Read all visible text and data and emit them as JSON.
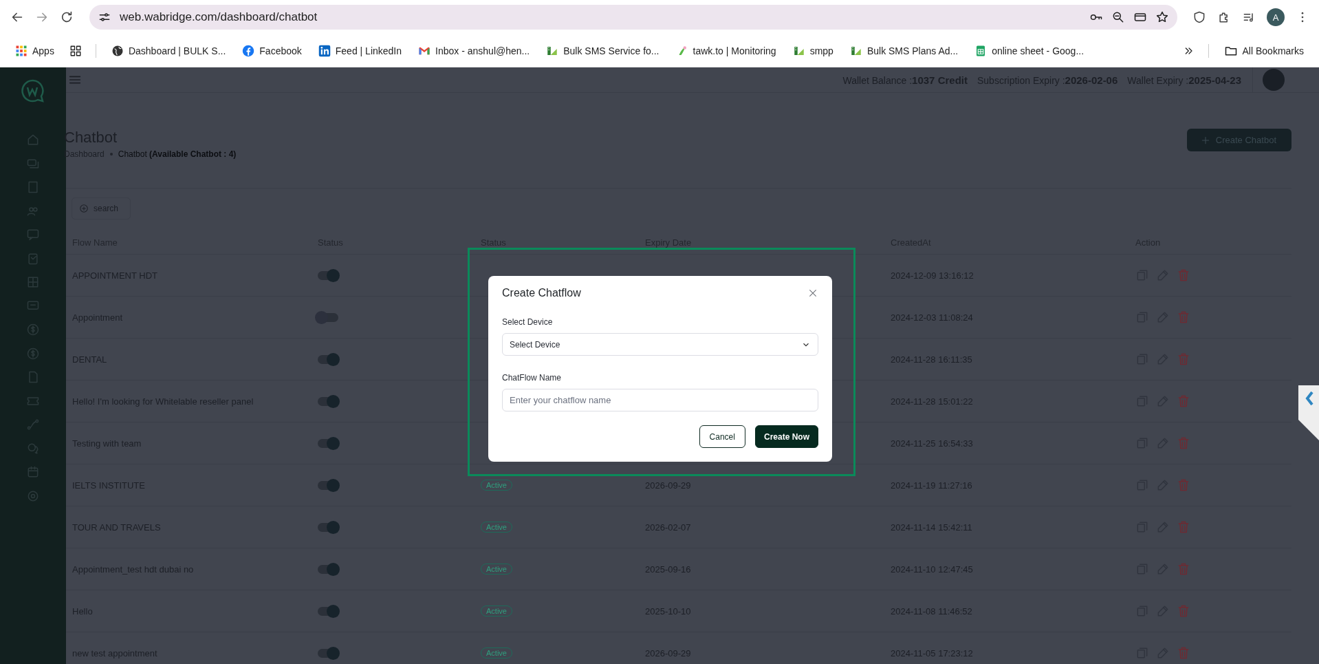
{
  "browser": {
    "url": "web.wabridge.com/dashboard/chatbot",
    "profile": "A",
    "bookmarks": [
      {
        "label": "Apps",
        "kind": "apps"
      },
      {
        "label": "Dashboard | BULK S...",
        "kind": "globe"
      },
      {
        "label": "Facebook",
        "kind": "facebook"
      },
      {
        "label": "Feed | LinkedIn",
        "kind": "linkedin"
      },
      {
        "label": "Inbox - anshul@hen...",
        "kind": "mail"
      },
      {
        "label": "Bulk SMS Service fo...",
        "kind": "bulk"
      },
      {
        "label": "tawk.to | Monitoring",
        "kind": "tawk"
      },
      {
        "label": "smpp",
        "kind": "bulk"
      },
      {
        "label": "Bulk SMS Plans Ad...",
        "kind": "bulk"
      },
      {
        "label": "online sheet - Goog...",
        "kind": "sheet"
      }
    ],
    "all_bookmarks": "All Bookmarks"
  },
  "header": {
    "wallet_balance": "Wallet Balance :**1037 Credit**",
    "subscription_expiry": "Subscription Expiry :**2026-02-06**",
    "wallet_expiry": "Wallet Expiry :**2025-04-23**"
  },
  "page": {
    "title": "Chatbot",
    "breadcrumb_home": "Dashboard",
    "breadcrumb_current": "Chatbot **(Available Chatbot : 4)**",
    "create_button": "Create Chatbot",
    "search_button": "search"
  },
  "table": {
    "columns": [
      "Flow Name",
      "Status",
      "Status",
      "Expiry Date",
      "CreatedAt",
      "Action"
    ],
    "rows": [
      {
        "name": "APPOINTMENT HDT",
        "on": true,
        "created": "2024-12-09 13:16:12"
      },
      {
        "name": "Appointment",
        "on": false,
        "created": "2024-12-03 11:08:24"
      },
      {
        "name": "DENTAL",
        "on": true,
        "created": "2024-11-28 16:11:35"
      },
      {
        "name": "Hello! I'm looking for Whitelable reseller panel",
        "on": true,
        "created": "2024-11-28 15:01:22"
      },
      {
        "name": "Testing with team",
        "on": true,
        "created": "2024-11-25 16:54:33"
      },
      {
        "name": "IELTS INSTITUTE",
        "on": true,
        "status": "Active",
        "expiry": "2026-09-29",
        "created": "2024-11-19 11:27:16"
      },
      {
        "name": "TOUR AND TRAVELS",
        "on": true,
        "status": "Active",
        "expiry": "2026-02-07",
        "created": "2024-11-14 15:42:11"
      },
      {
        "name": "Appointment_test hdt dubai no",
        "on": true,
        "status": "Active",
        "expiry": "2025-09-16",
        "created": "2024-11-10 12:47:45"
      },
      {
        "name": "Hello",
        "on": true,
        "status": "Active",
        "expiry": "2025-10-10",
        "created": "2024-11-08 11:46:52"
      },
      {
        "name": "new test appointment",
        "on": true,
        "status": "Active",
        "expiry": "2026-09-29",
        "created": "2024-11-05 17:23:12"
      }
    ]
  },
  "modal": {
    "title": "Create Chatflow",
    "device_label": "Select Device",
    "device_value": "Select Device",
    "name_label": "ChatFlow Name",
    "name_placeholder": "Enter your chatflow name",
    "cancel": "Cancel",
    "submit": "Create Now"
  }
}
